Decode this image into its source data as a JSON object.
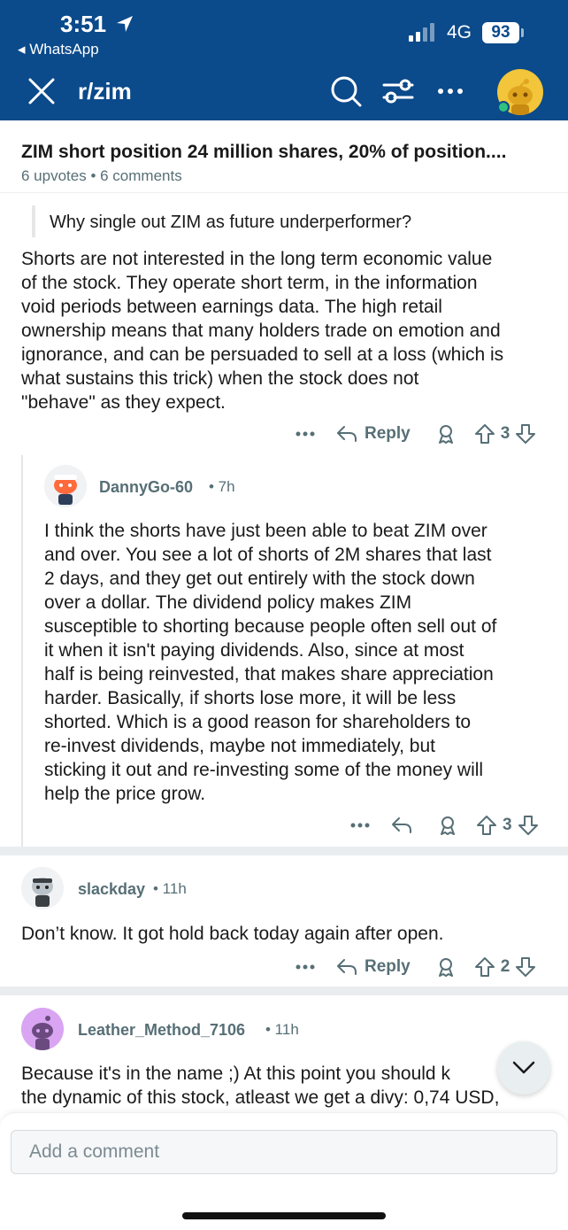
{
  "status": {
    "time": "3:51",
    "back_app": "◂ WhatsApp",
    "network": "4G",
    "battery": "93"
  },
  "header": {
    "subreddit": "r/zim"
  },
  "post": {
    "title": "ZIM short position 24 million shares, 20% of position....",
    "meta": "6 upvotes • 6 comments"
  },
  "comment1": {
    "quote": "Why single out ZIM as future underperformer?",
    "lines": [
      "Shorts are not interested in the long term economic value",
      "of the stock. They operate short term, in the information",
      "void periods between earnings data. The high retail",
      "ownership means that many holders trade on emotion and",
      "ignorance, and can be persuaded to sell at a loss (which is",
      "what sustains this trick) when the stock does not",
      "\"behave\" as they expect."
    ],
    "reply_label": "Reply",
    "votes": "3"
  },
  "comment2": {
    "username": "DannyGo-60",
    "age": "• 7h",
    "lines": [
      "I think the shorts have just been able to beat ZIM over",
      "and over.   You see a lot of shorts of 2M shares that last",
      "2 days, and they get out entirely with the stock down",
      "over a dollar. The dividend policy makes ZIM",
      "susceptible to shorting because people often sell out of",
      "it when it isn't paying dividends.   Also, since at most",
      "half is being reinvested, that makes share appreciation",
      "harder.   Basically, if shorts lose more, it will be less",
      "shorted.   Which is a good reason for shareholders to",
      "re-invest dividends, maybe not immediately, but",
      "sticking it out and re-investing some of the money will",
      "help the price grow."
    ],
    "votes": "3"
  },
  "comment3": {
    "username": "slackday",
    "age": "• 11h",
    "text": "Don’t know. It got hold back today again after open.",
    "reply_label": "Reply",
    "votes": "2"
  },
  "comment4": {
    "username": "Leather_Method_7106",
    "age": "• 11h",
    "lines": [
      "Because it's in the name ;) At this point you should k",
      "the dynamic of this stock, atleast we get a divy: 0,74 USD,"
    ]
  },
  "composer": {
    "placeholder": "Add a comment"
  },
  "icons": {
    "close": "close-icon",
    "search": "search-icon",
    "filter": "filter-icon",
    "more": "more-icon",
    "reply": "reply-icon",
    "award": "award-icon",
    "upvote": "upvote-icon",
    "downvote": "downvote-icon",
    "scroll_down": "chevron-down-icon"
  },
  "colors": {
    "header_bg": "#0b4a8b",
    "meta_text": "#576f76",
    "avatar_yellow": "#f2c53a",
    "avatar_purple": "#d9a5f2"
  }
}
